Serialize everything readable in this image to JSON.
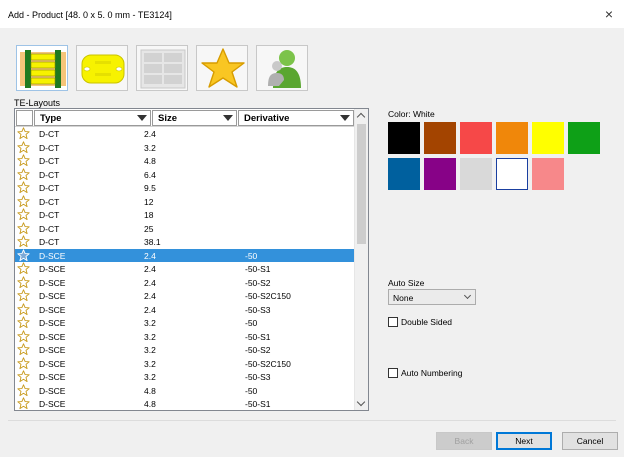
{
  "window": {
    "title": "Add - Product [48. 0 x 5. 0 mm - TE3124]",
    "close_glyph": "×"
  },
  "toolbar": {
    "tiles": [
      {
        "name": "ladder-label-icon",
        "selected": true
      },
      {
        "name": "yellow-tag-icon",
        "selected": false
      },
      {
        "name": "grid-sheet-icon",
        "selected": false
      },
      {
        "name": "favorites-star-icon",
        "selected": false
      },
      {
        "name": "user-icon",
        "selected": false
      }
    ]
  },
  "layouts": {
    "section_label": "TE-Layouts",
    "columns": {
      "type": "Type",
      "size": "Size",
      "derivative": "Derivative"
    },
    "rows": [
      {
        "type": "D-CT",
        "size": "2.4",
        "derivative": "",
        "selected": false
      },
      {
        "type": "D-CT",
        "size": "3.2",
        "derivative": "",
        "selected": false
      },
      {
        "type": "D-CT",
        "size": "4.8",
        "derivative": "",
        "selected": false
      },
      {
        "type": "D-CT",
        "size": "6.4",
        "derivative": "",
        "selected": false
      },
      {
        "type": "D-CT",
        "size": "9.5",
        "derivative": "",
        "selected": false
      },
      {
        "type": "D-CT",
        "size": "12",
        "derivative": "",
        "selected": false
      },
      {
        "type": "D-CT",
        "size": "18",
        "derivative": "",
        "selected": false
      },
      {
        "type": "D-CT",
        "size": "25",
        "derivative": "",
        "selected": false
      },
      {
        "type": "D-CT",
        "size": "38.1",
        "derivative": "",
        "selected": false
      },
      {
        "type": "D-SCE",
        "size": "2.4",
        "derivative": "-50",
        "selected": true
      },
      {
        "type": "D-SCE",
        "size": "2.4",
        "derivative": "-50-S1",
        "selected": false
      },
      {
        "type": "D-SCE",
        "size": "2.4",
        "derivative": "-50-S2",
        "selected": false
      },
      {
        "type": "D-SCE",
        "size": "2.4",
        "derivative": "-50-S2C150",
        "selected": false
      },
      {
        "type": "D-SCE",
        "size": "2.4",
        "derivative": "-50-S3",
        "selected": false
      },
      {
        "type": "D-SCE",
        "size": "3.2",
        "derivative": "-50",
        "selected": false
      },
      {
        "type": "D-SCE",
        "size": "3.2",
        "derivative": "-50-S1",
        "selected": false
      },
      {
        "type": "D-SCE",
        "size": "3.2",
        "derivative": "-50-S2",
        "selected": false
      },
      {
        "type": "D-SCE",
        "size": "3.2",
        "derivative": "-50-S2C150",
        "selected": false
      },
      {
        "type": "D-SCE",
        "size": "3.2",
        "derivative": "-50-S3",
        "selected": false
      },
      {
        "type": "D-SCE",
        "size": "4.8",
        "derivative": "-50",
        "selected": false
      },
      {
        "type": "D-SCE",
        "size": "4.8",
        "derivative": "-50-S1",
        "selected": false
      }
    ]
  },
  "color": {
    "label": "Color: White",
    "swatches": [
      {
        "name": "black",
        "hex": "#000000",
        "selected": false
      },
      {
        "name": "brown",
        "hex": "#a34400",
        "selected": false
      },
      {
        "name": "red",
        "hex": "#f64848",
        "selected": false
      },
      {
        "name": "orange",
        "hex": "#f0870a",
        "selected": false
      },
      {
        "name": "yellow",
        "hex": "#ffff00",
        "selected": false
      },
      {
        "name": "green",
        "hex": "#0ea017",
        "selected": false
      },
      {
        "name": "blue",
        "hex": "#00609e",
        "selected": false
      },
      {
        "name": "violet",
        "hex": "#870287",
        "selected": false
      },
      {
        "name": "grey",
        "hex": "#d9d9d9",
        "selected": false
      },
      {
        "name": "white",
        "hex": "#ffffff",
        "selected": true
      },
      {
        "name": "pink",
        "hex": "#f7888a",
        "selected": false
      }
    ]
  },
  "auto_size": {
    "label": "Auto Size",
    "selected": "None"
  },
  "options": {
    "double_sided": "Double Sided",
    "auto_numbering": "Auto Numbering"
  },
  "buttons": {
    "back": "Back",
    "next": "Next",
    "cancel": "Cancel"
  }
}
